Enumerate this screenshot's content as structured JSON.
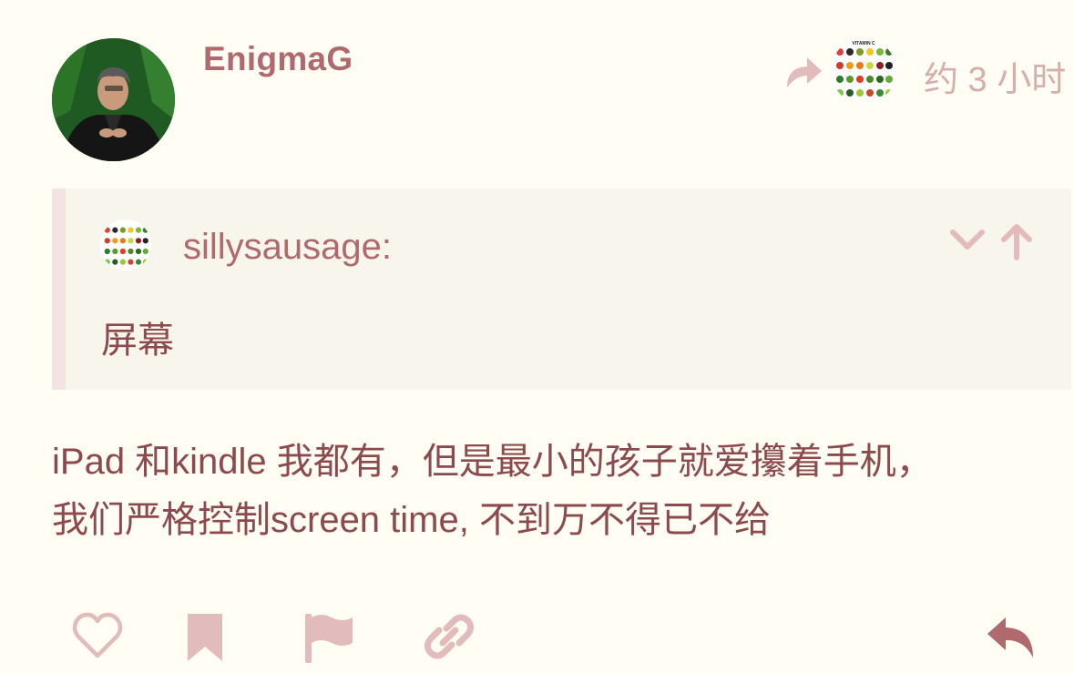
{
  "post": {
    "username": "EnigmaG",
    "timestamp": "约 3 小时",
    "reply_to_avatar_caption": "VITAMIN C",
    "quote": {
      "username": "sillysausage:",
      "text": "屏幕"
    },
    "body_line1": "iPad 和kindle 我都有，但是最小的孩子就爱攥着手机，",
    "body_line2": "我们严格控制screen time, 不到万不得已不给"
  },
  "colors": {
    "background": "#fffdf4",
    "username": "#b06a6e",
    "body_text": "#8c4a4d",
    "muted_icon": "#e2bcbc",
    "quote_background": "#f8f6ec",
    "quote_border": "#f2e4e2",
    "reply_icon": "#b06a6e"
  },
  "icons": {
    "reply_to": "share-arrow-icon",
    "collapse": "chevron-down-icon",
    "go_to_quote": "arrow-up-icon",
    "like": "heart-icon",
    "bookmark": "bookmark-icon",
    "flag": "flag-icon",
    "link": "link-icon",
    "reply": "reply-icon"
  }
}
